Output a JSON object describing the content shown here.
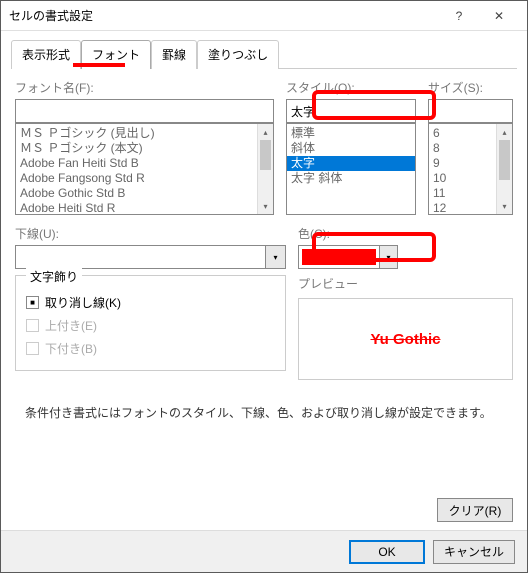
{
  "titlebar": {
    "title": "セルの書式設定"
  },
  "tabs": {
    "display": "表示形式",
    "font": "フォント",
    "border": "罫線",
    "fill": "塗りつぶし",
    "active": "font"
  },
  "labels": {
    "fontname": "フォント名(F):",
    "style": "スタイル(O):",
    "size": "サイズ(S):",
    "underline": "下線(U):",
    "color": "色(C):",
    "effects_title": "文字飾り",
    "preview_title": "プレビュー"
  },
  "inputs": {
    "fontname_value": "",
    "style_value": "太字",
    "size_value": ""
  },
  "font_list": [
    "ＭＳ Ｐゴシック (見出し)",
    "ＭＳ Ｐゴシック (本文)",
    "Adobe Fan Heiti Std B",
    "Adobe Fangsong Std R",
    "Adobe Gothic Std B",
    "Adobe Heiti Std R"
  ],
  "style_list": [
    "標準",
    "斜体",
    "太字",
    "太字 斜体"
  ],
  "style_selected_index": 2,
  "size_list": [
    "6",
    "8",
    "9",
    "10",
    "11",
    "12"
  ],
  "color_value": "#ff0000",
  "effects": {
    "strike": {
      "label": "取り消し線(K)",
      "checked": true
    },
    "superscript": {
      "label": "上付き(E)",
      "checked": false,
      "disabled": true
    },
    "subscript": {
      "label": "下付き(B)",
      "checked": false,
      "disabled": true
    }
  },
  "preview_text": "Yu Gothic",
  "note_text": "条件付き書式にはフォントのスタイル、下線、色、および取り消し線が設定できます。",
  "buttons": {
    "clear": "クリア(R)",
    "ok": "OK",
    "cancel": "キャンセル"
  }
}
